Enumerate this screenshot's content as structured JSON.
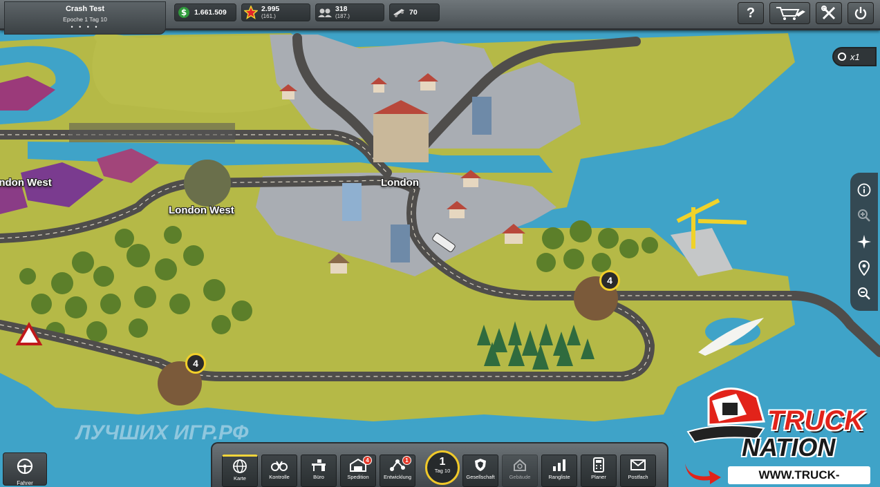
{
  "company": {
    "name": "Crash Test",
    "date": "Epoche 1 Tag 10",
    "dots": "• • • •"
  },
  "stats": {
    "money": {
      "value": "1.661.509"
    },
    "stars": {
      "value": "2.995",
      "sub": "(161.)"
    },
    "fans": {
      "value": "318",
      "sub": "(187.)"
    },
    "trucks": {
      "value": "70"
    }
  },
  "top_buttons": {
    "help": "?"
  },
  "map": {
    "cities": [
      "London",
      "London West",
      "London West"
    ],
    "site_markers": [
      "4",
      "4"
    ],
    "speed": "x1"
  },
  "bottom_nav": {
    "items": [
      {
        "label": "Karte"
      },
      {
        "label": "Kontrolle"
      },
      {
        "label": "Büro"
      },
      {
        "label": "Spedition",
        "badge": "4"
      },
      {
        "label": "Entwicklung",
        "badge": "1"
      },
      {
        "label": "Gesellschaft"
      },
      {
        "label": "Gebäude"
      },
      {
        "label": "Rangliste"
      },
      {
        "label": "Planer"
      },
      {
        "label": "Postfach"
      }
    ],
    "day": {
      "number": "1",
      "label": "Tag 10"
    }
  },
  "driver_button": {
    "label": "Fahrer"
  },
  "watermark": {
    "text": "ЛУЧШИХ ИГР.РФ"
  },
  "logo": {
    "line1": "TRUCK",
    "line2": "NATION",
    "url": "WWW.TRUCK-NATION.NET"
  },
  "colors": {
    "accent": "#f2cf2a",
    "badge": "#e33a2a",
    "water": "#3fa3c8",
    "land": "#b5b947"
  }
}
